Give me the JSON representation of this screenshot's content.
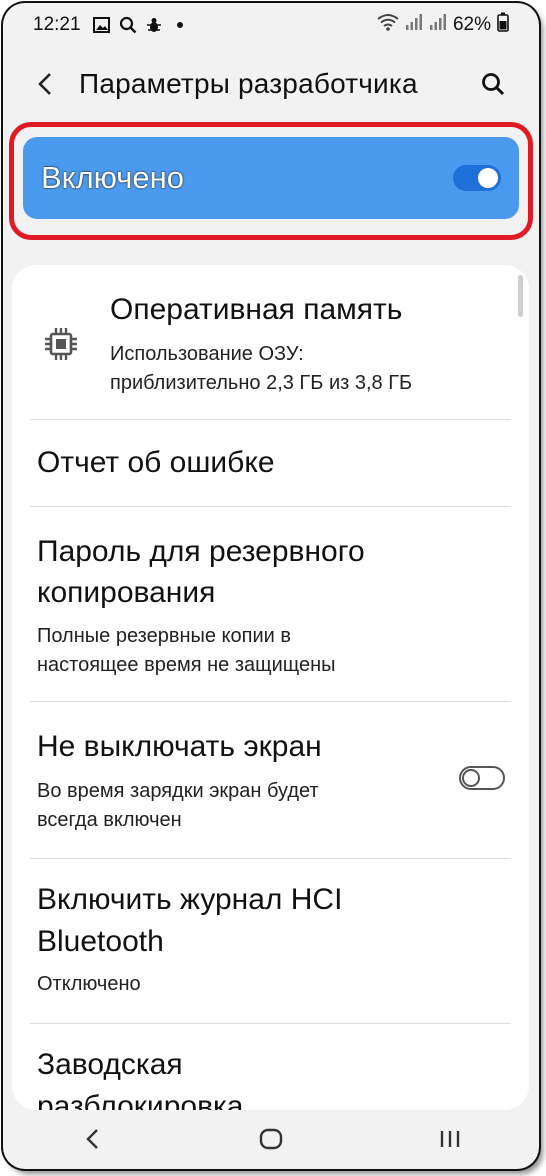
{
  "status_bar": {
    "time": "12:21",
    "battery": "62%",
    "icons": [
      "gallery-icon",
      "search-status-icon",
      "bug-icon",
      "dot-icon",
      "wifi-icon",
      "signal-icon",
      "signal-icon",
      "battery-icon"
    ]
  },
  "header": {
    "title": "Параметры разработчика",
    "back_icon": "chevron-left-icon",
    "search_icon": "search-icon"
  },
  "master_toggle": {
    "label": "Включено",
    "state": "on",
    "accent": "#4a9bf0",
    "highlight_color": "#e01b24"
  },
  "items": [
    {
      "title": "Оперативная память",
      "subtitle_line1": "Использование ОЗУ:",
      "subtitle_line2": "приблизительно 2,3 ГБ из 3,8 ГБ",
      "icon": "memory-chip-icon"
    },
    {
      "title": "Отчет об ошибке"
    },
    {
      "title_line1": "Пароль для резервного",
      "title_line2": "копирования",
      "subtitle_line1": "Полные резервные копии в",
      "subtitle_line2": "настоящее время не защищены"
    },
    {
      "title": "Не выключать экран",
      "subtitle_line1": "Во время зарядки экран будет",
      "subtitle_line2": "всегда включен",
      "toggle": "off"
    },
    {
      "title_line1": "Включить журнал HCI",
      "title_line2": "Bluetooth",
      "subtitle": "Отключено"
    },
    {
      "title_line1": "Заводская",
      "title_line2": "разблокировка",
      "toggle": "off"
    }
  ],
  "nav_bar": {
    "back_icon": "nav-back-icon",
    "home_icon": "nav-home-icon",
    "recents_icon": "nav-recents-icon"
  }
}
